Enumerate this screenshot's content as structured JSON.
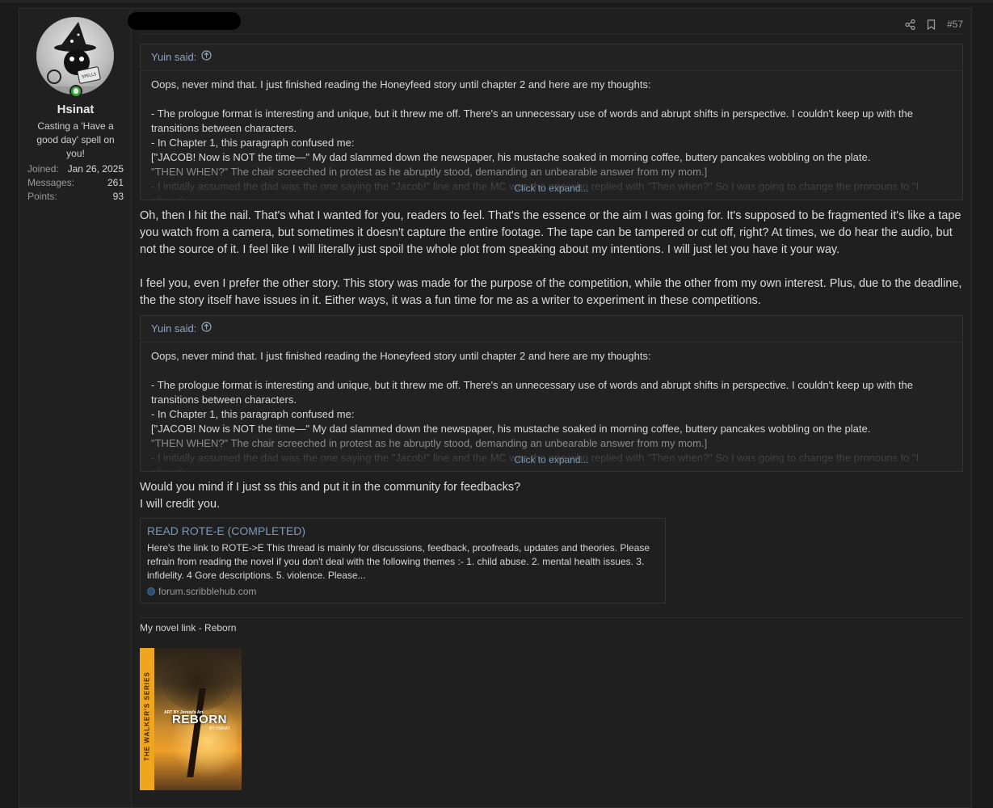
{
  "user": {
    "name": "Hsinat",
    "title": "Casting a 'Have a good day' spell on you!",
    "stats": [
      {
        "label": "Joined:",
        "value": "Jan 26, 2025"
      },
      {
        "label": "Messages:",
        "value": "261"
      },
      {
        "label": "Points:",
        "value": "93"
      }
    ]
  },
  "post": {
    "number": "#57",
    "icons": [
      "share-icon",
      "bookmark-icon"
    ]
  },
  "quotes": [
    {
      "author": "Yuin said:",
      "lines": [
        "Oops, never mind that. I just finished reading the Honeyfeed story until chapter 2 and here are my thoughts:",
        "",
        "- The prologue format is interesting and unique, but it threw me off. There's an unnecessary use of words and abrupt shifts in perspective. I couldn't keep up with the transitions between characters.",
        "- In Chapter 1, this paragraph confused me:",
        "[\"JACOB! Now is NOT the time—\" My dad slammed down the newspaper, his mustache soaked in morning coffee, buttery pancakes wobbling on the plate.",
        "\"THEN WHEN?\" The chair screeched in protest as he abruptly stood, demanding an unbearable answer from my mom.]",
        "- I initially assumed the dad was the one saying the \"Jacob!\" line and the MC was the one who replied with \"Then when?\" So I was going to change the pronouns to \"I abruptly"
      ],
      "expand_label": "Click to expand..."
    },
    {
      "author": "Yuin said:",
      "lines": [
        "Oops, never mind that. I just finished reading the Honeyfeed story until chapter 2 and here are my thoughts:",
        "",
        "- The prologue format is interesting and unique, but it threw me off. There's an unnecessary use of words and abrupt shifts in perspective. I couldn't keep up with the transitions between characters.",
        "- In Chapter 1, this paragraph confused me:",
        "[\"JACOB! Now is NOT the time—\" My dad slammed down the newspaper, his mustache soaked in morning coffee, buttery pancakes wobbling on the plate.",
        "\"THEN WHEN?\" The chair screeched in protest as he abruptly stood, demanding an unbearable answer from my mom.]",
        "- I initially assumed the dad was the one saying the \"Jacob!\" line and the MC was the one who replied with \"Then when?\" So I was going to change the pronouns to \"I abruptly"
      ],
      "expand_label": "Click to expand..."
    }
  ],
  "reply1": {
    "p1": "Oh, then I hit the nail. That's what I wanted for you, readers to feel. That's the essence or the aim I was going for. It's supposed to be fragmented it's like a tape you watch from a camera, but sometimes it doesn't capture the entire footage. The tape can be tampered or cut off, right? At times, we do hear the audio, but not the source of it. I feel like I will literally just spoil the whole plot from speaking about my intentions. I will just let you have it your way.",
    "p2": "I feel you, even I prefer the other story. This story was made for the purpose of the competition, while the other from my own interest. Plus, due to the deadline, the the story itself have issues in it. Either ways, it was a fun time for me as a writer to experiment in these competitions."
  },
  "reply2": {
    "line1": "Would you mind if I just ss this and put it in the community for feedbacks?",
    "line2": "I will credit you."
  },
  "embed": {
    "title": "READ ROTE-E (COMPLETED)",
    "description": "Here's the link to ROTE->E This thread is mainly for discussions, feedback, proofreads, updates and theories. Please refrain from reading the novel if you don't deal with the following themes :- 1. child abuse. 2. mental health issues. 3. infidelity. 4 Gore descriptions. 5. violence. Please...",
    "site": "forum.scribblehub.com"
  },
  "signature": {
    "text": "My novel link - Reborn"
  },
  "cover": {
    "series": "THE WALKER'S SERIES",
    "art_credit": "ART BY Jersey's Art",
    "title": "REBORN",
    "author": "BY HSINAT"
  }
}
